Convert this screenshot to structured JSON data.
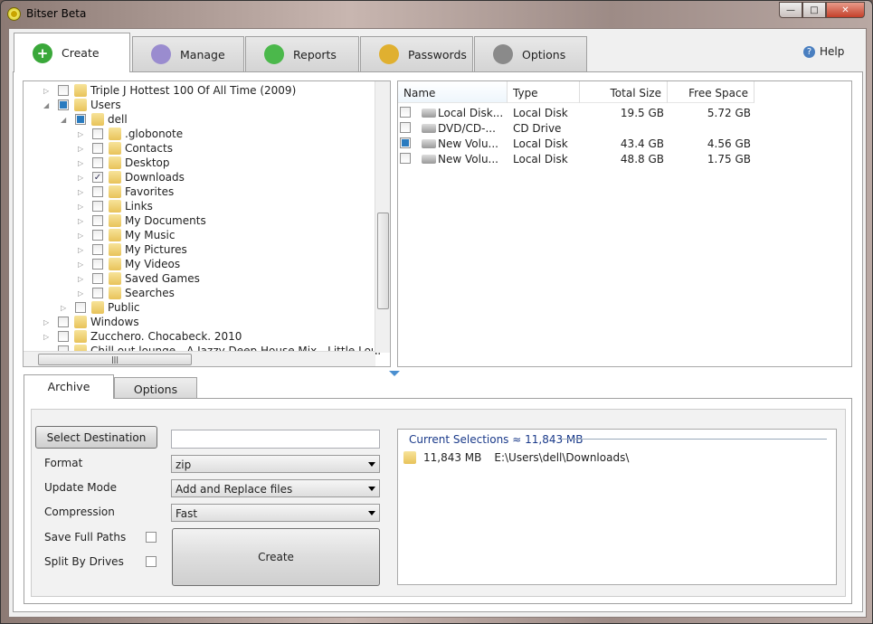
{
  "window": {
    "title": "Bitser Beta",
    "minimize": "—",
    "maximize": "□",
    "close": "✕"
  },
  "tabs": [
    {
      "label": "Create",
      "icon": "plus-circle-icon",
      "color": "#3aa83a"
    },
    {
      "label": "Manage",
      "icon": "manage-icon",
      "color": "#9a8ccf"
    },
    {
      "label": "Reports",
      "icon": "pie-chart-icon",
      "color": "#4bb84b"
    },
    {
      "label": "Passwords",
      "icon": "padlock-icon",
      "color": "#e0b030"
    },
    {
      "label": "Options",
      "icon": "wrench-icon",
      "color": "#8a8a8a"
    }
  ],
  "help": "Help",
  "tree": [
    {
      "label": "Triple J Hottest 100 Of All Time (2009)",
      "level": 0,
      "state": "unchecked",
      "expander": "collapsed"
    },
    {
      "label": "Users",
      "level": 0,
      "state": "partial",
      "expander": "expanded"
    },
    {
      "label": "dell",
      "level": 1,
      "state": "partial",
      "expander": "expanded"
    },
    {
      "label": ".globonote",
      "level": 2,
      "state": "unchecked",
      "expander": "collapsed"
    },
    {
      "label": "Contacts",
      "level": 2,
      "state": "unchecked",
      "expander": "collapsed"
    },
    {
      "label": "Desktop",
      "level": 2,
      "state": "unchecked",
      "expander": "collapsed"
    },
    {
      "label": "Downloads",
      "level": 2,
      "state": "checked",
      "expander": "collapsed"
    },
    {
      "label": "Favorites",
      "level": 2,
      "state": "unchecked",
      "expander": "collapsed"
    },
    {
      "label": "Links",
      "level": 2,
      "state": "unchecked",
      "expander": "collapsed"
    },
    {
      "label": "My Documents",
      "level": 2,
      "state": "unchecked",
      "expander": "collapsed"
    },
    {
      "label": "My Music",
      "level": 2,
      "state": "unchecked",
      "expander": "collapsed"
    },
    {
      "label": "My Pictures",
      "level": 2,
      "state": "unchecked",
      "expander": "collapsed"
    },
    {
      "label": "My Videos",
      "level": 2,
      "state": "unchecked",
      "expander": "collapsed"
    },
    {
      "label": "Saved Games",
      "level": 2,
      "state": "unchecked",
      "expander": "collapsed"
    },
    {
      "label": "Searches",
      "level": 2,
      "state": "unchecked",
      "expander": "collapsed"
    },
    {
      "label": "Public",
      "level": 1,
      "state": "unchecked",
      "expander": "collapsed"
    },
    {
      "label": "Windows",
      "level": 0,
      "state": "unchecked",
      "expander": "collapsed"
    },
    {
      "label": "Zucchero. Chocabeck. 2010",
      "level": 0,
      "state": "unchecked",
      "expander": "collapsed"
    },
    {
      "label": "Chill out lounge - A Jazzy Deep House Mix - Little Loui",
      "level": 0,
      "state": "unchecked",
      "expander": "none"
    }
  ],
  "drives": {
    "columns": [
      "Name",
      "Type",
      "Total Size",
      "Free Space"
    ],
    "rows": [
      {
        "name": "Local Disk...",
        "type": "Local Disk",
        "total": "19.5 GB",
        "free": "5.72 GB",
        "checked": false
      },
      {
        "name": "DVD/CD-...",
        "type": "CD Drive",
        "total": "",
        "free": "",
        "checked": false
      },
      {
        "name": "New Volu...",
        "type": "Local Disk",
        "total": "43.4 GB",
        "free": "4.56 GB",
        "checked": true
      },
      {
        "name": "New Volu...",
        "type": "Local Disk",
        "total": "48.8 GB",
        "free": "1.75 GB",
        "checked": false
      }
    ]
  },
  "bottom_tabs": [
    "Archive",
    "Options"
  ],
  "archive": {
    "select_destination": "Select Destination",
    "destination_value": "",
    "format_label": "Format",
    "format_value": "zip",
    "update_label": "Update Mode",
    "update_value": "Add and Replace files",
    "compression_label": "Compression",
    "compression_value": "Fast",
    "save_paths_label": "Save Full Paths",
    "split_label": "Split By Drives",
    "create": "Create",
    "current_title": "Current Selections ≈ 11,843 MB",
    "selections": [
      {
        "size": "11,843 MB",
        "path": "E:\\Users\\dell\\Downloads\\"
      }
    ]
  }
}
